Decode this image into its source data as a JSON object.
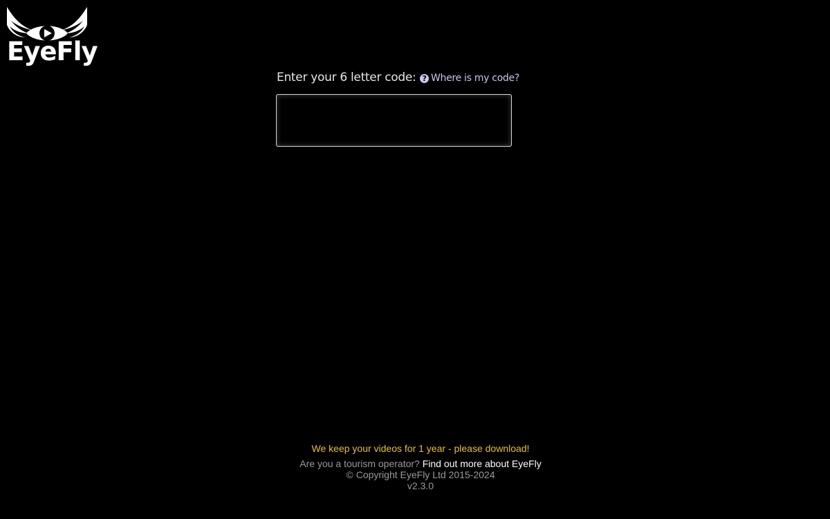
{
  "brand": {
    "name": "EyeFly",
    "logo_icon": "winged-eye-play-icon"
  },
  "code_entry": {
    "label": "Enter your 6 letter code:",
    "help_link": "Where is my code?",
    "help_icon": "question-circle-icon",
    "value": "",
    "placeholder": ""
  },
  "footer": {
    "retention_notice": "We keep your videos for 1 year - please download!",
    "operator_prompt": "Are you a tourism operator?",
    "operator_link": "Find out more about EyeFly",
    "copyright": "© Copyright EyeFly Ltd 2015-2024",
    "version": "v2.3.0"
  },
  "colors": {
    "background": "#000000",
    "notice": "#e8c22c",
    "help_link": "#c9c8ef",
    "muted_text": "#9a9a9a"
  }
}
